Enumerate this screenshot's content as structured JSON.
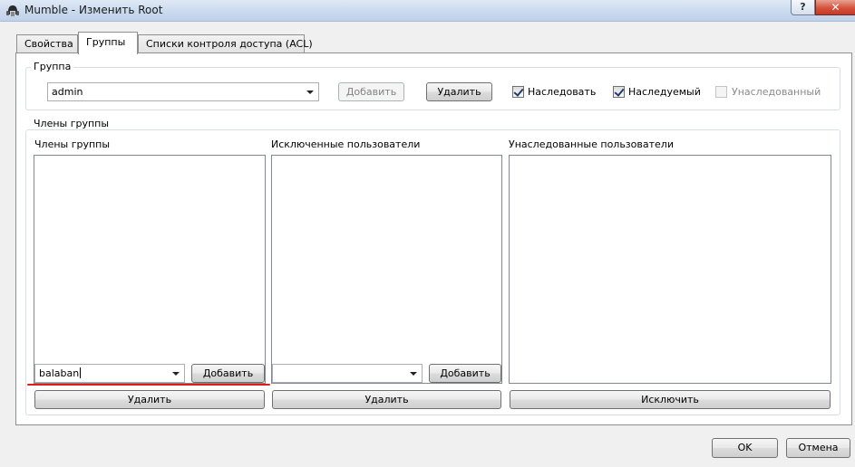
{
  "window": {
    "title": "Mumble - Изменить Root",
    "help_label": "?",
    "close_label": "✕"
  },
  "tabs": [
    {
      "label": "Свойства",
      "active": false
    },
    {
      "label": "Группы",
      "active": true
    },
    {
      "label": "Списки контроля доступа (ACL)",
      "active": false
    }
  ],
  "group_section": {
    "title": "Группа",
    "group_combo_value": "admin",
    "add_button": "Добавить",
    "remove_button": "Удалить",
    "inherit_label": "Наследовать",
    "inherit_checked": true,
    "inheritable_label": "Наследуемый",
    "inheritable_checked": true,
    "inherited_label": "Унаследованный",
    "inherited_checked": false
  },
  "members_section": {
    "title": "Члены группы",
    "members": {
      "label": "Члены группы",
      "items": [],
      "input_value": "balaban",
      "add_button": "Добавить",
      "remove_button": "Удалить"
    },
    "excluded": {
      "label": "Исключенные пользователи",
      "items": [],
      "input_value": "",
      "add_button": "Добавить",
      "remove_button": "Удалить"
    },
    "inherited": {
      "label": "Унаследованные пользователи",
      "items": [],
      "exclude_button": "Исключить"
    }
  },
  "footer": {
    "ok_button": "OK",
    "cancel_button": "Отмена"
  }
}
